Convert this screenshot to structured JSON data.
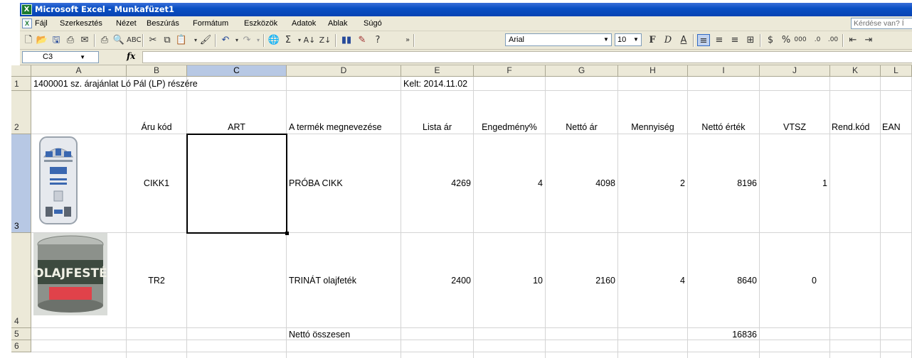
{
  "window": {
    "title": "Microsoft Excel - Munkafüzet1"
  },
  "menu": {
    "items": [
      "Fájl",
      "Szerkesztés",
      "Nézet",
      "Beszúrás",
      "Formátum",
      "Eszközök",
      "Adatok",
      "Ablak",
      "Súgó"
    ],
    "help_placeholder": "Kérdése van? Í"
  },
  "toolbar": {
    "font_name": "Arial",
    "font_size": "10"
  },
  "formula_bar": {
    "cell_ref": "C3",
    "fx_label": "fx",
    "formula": ""
  },
  "sheet": {
    "columns": [
      "A",
      "B",
      "C",
      "D",
      "E",
      "F",
      "G",
      "H",
      "I",
      "J",
      "K",
      "L"
    ],
    "rows": [
      "1",
      "2",
      "3",
      "4",
      "5",
      "6"
    ],
    "selected_cell": "C3",
    "row1": {
      "a": "1400001 sz. árajánlat Ló Pál (LP) részére",
      "e": "Kelt: 2014.11.02"
    },
    "headers": {
      "b": "Áru kód",
      "c": "ART",
      "d": "A termék megnevezése",
      "e": "Lista ár",
      "f": "Engedmény%",
      "g": "Nettó ár",
      "h": "Mennyiség",
      "i": "Nettó érték",
      "j": "VTSZ",
      "k": "Rend.kód",
      "l": "EAN"
    },
    "items": [
      {
        "code": "CIKK1",
        "name": "PRÓBA CIKK",
        "list_price": "4269",
        "discount": "4",
        "net_price": "4098",
        "qty": "2",
        "net_value": "8196",
        "vtsz": "1",
        "image": "r2d2-phone-case"
      },
      {
        "code": "TR2",
        "name": "TRINÁT olajfeték",
        "list_price": "2400",
        "discount": "10",
        "net_price": "2160",
        "qty": "4",
        "net_value": "8640",
        "vtsz": "0",
        "image": "paint-can"
      }
    ],
    "can_label": "OLAJFESTÉ",
    "total": {
      "label": "Nettó összesen",
      "value": "16836"
    }
  },
  "colors": {
    "titlebar": "#0a4fc4",
    "chrome": "#ece9d8",
    "header_active": "#b7c8e4",
    "grid": "#d4d4d4"
  }
}
